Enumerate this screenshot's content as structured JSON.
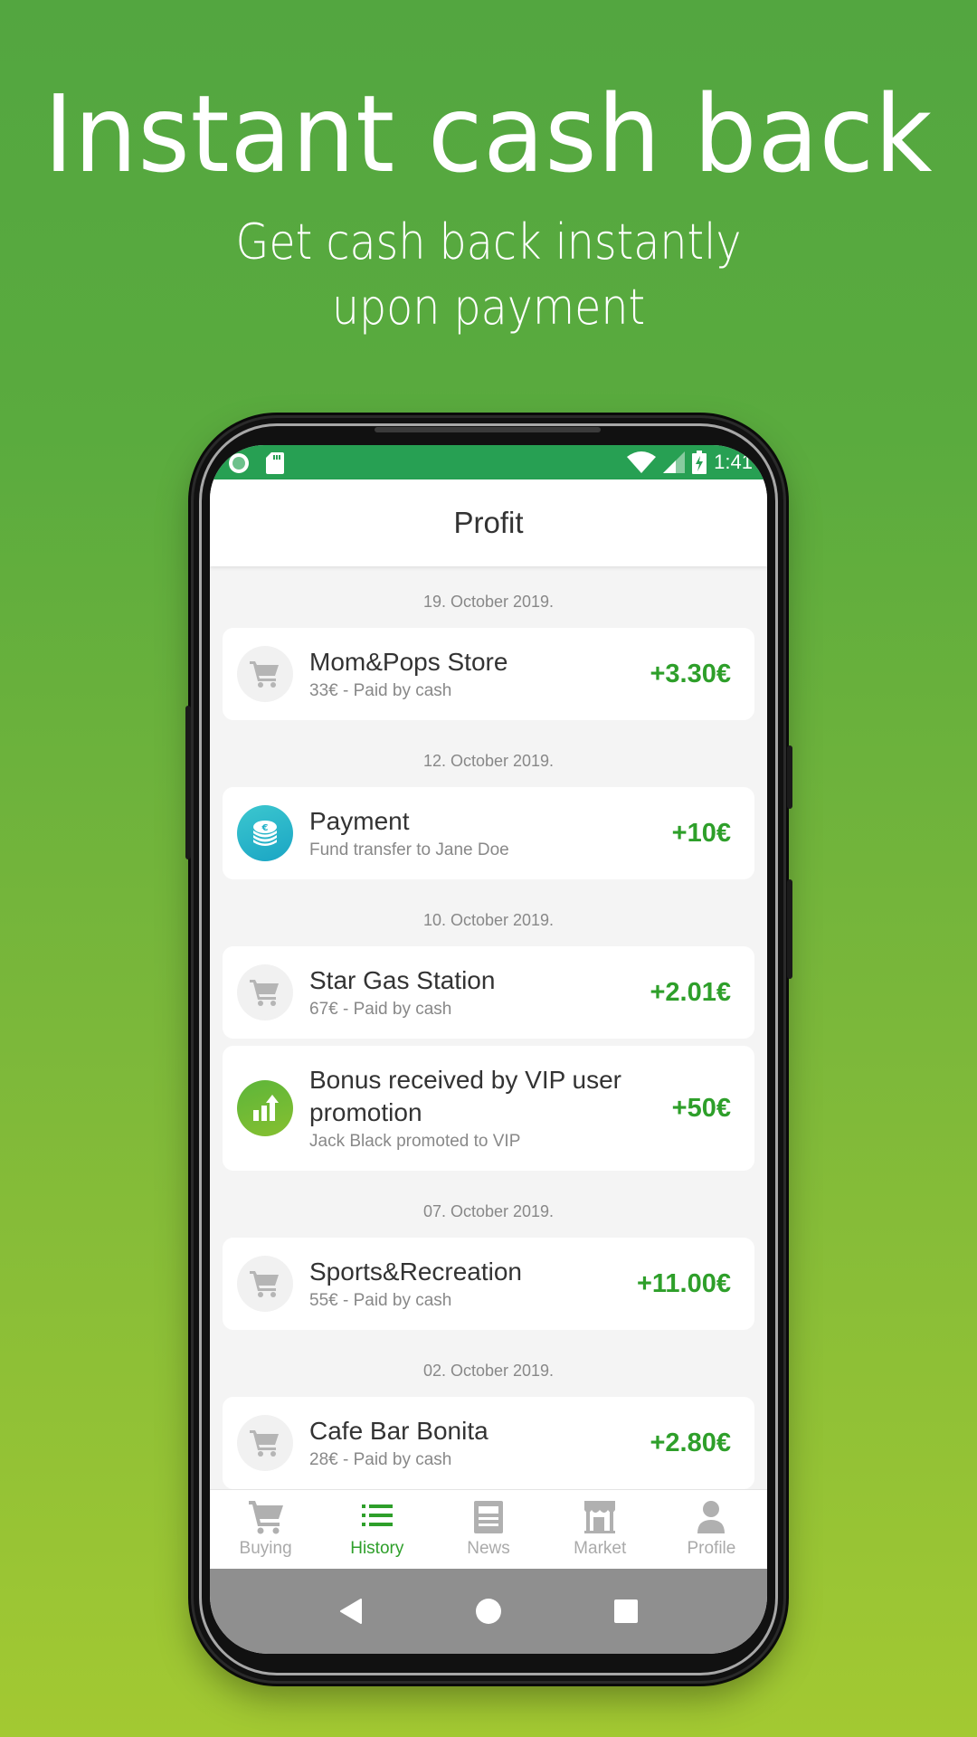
{
  "hero": {
    "title": "Instant cash back",
    "subtitle_line1": "Get cash back instantly",
    "subtitle_line2": "upon payment"
  },
  "statusbar": {
    "left_icons": [
      "notification-circle-icon",
      "sd-card-icon"
    ],
    "right_icons": [
      "wifi-icon",
      "cellular-signal-icon",
      "battery-charging-icon"
    ],
    "time": "1:41",
    "color": "#27a053"
  },
  "appbar": {
    "title": "Profit"
  },
  "colors": {
    "accent": "#2e9f2a",
    "amount": "#2e9f2a",
    "inactive_tab": "#aaaaaa",
    "date_text": "#888888"
  },
  "history": [
    {
      "date": "19. October 2019.",
      "items": [
        {
          "icon": "shopping-cart-icon",
          "title": "Mom&Pops Store",
          "subtitle": "33€ - Paid by cash",
          "amount": "+3.30€"
        }
      ]
    },
    {
      "date": "12. October 2019.",
      "items": [
        {
          "icon": "euro-coins-icon",
          "title": "Payment",
          "subtitle": "Fund transfer to Jane Doe",
          "amount": "+10€"
        }
      ]
    },
    {
      "date": "10. October 2019.",
      "items": [
        {
          "icon": "shopping-cart-icon",
          "title": "Star Gas Station",
          "subtitle": "67€ - Paid by cash",
          "amount": "+2.01€"
        },
        {
          "icon": "bar-chart-up-icon",
          "title": "Bonus received by VIP user promotion",
          "subtitle": "Jack Black promoted to VIP",
          "amount": "+50€"
        }
      ]
    },
    {
      "date": "07. October 2019.",
      "items": [
        {
          "icon": "shopping-cart-icon",
          "title": "Sports&Recreation",
          "subtitle": "55€ - Paid by cash",
          "amount": "+11.00€"
        }
      ]
    },
    {
      "date": "02. October 2019.",
      "items": [
        {
          "icon": "shopping-cart-icon",
          "title": "Cafe Bar Bonita",
          "subtitle": "28€ - Paid by cash",
          "amount": "+2.80€"
        }
      ]
    }
  ],
  "tabs": [
    {
      "label": "Buying",
      "icon": "shopping-cart-icon",
      "active": false
    },
    {
      "label": "History",
      "icon": "list-icon",
      "active": true
    },
    {
      "label": "News",
      "icon": "newspaper-icon",
      "active": false
    },
    {
      "label": "Market",
      "icon": "storefront-icon",
      "active": false
    },
    {
      "label": "Profile",
      "icon": "person-icon",
      "active": false
    }
  ],
  "navbar": {
    "buttons": [
      "back-icon",
      "home-icon",
      "recents-icon"
    ]
  }
}
